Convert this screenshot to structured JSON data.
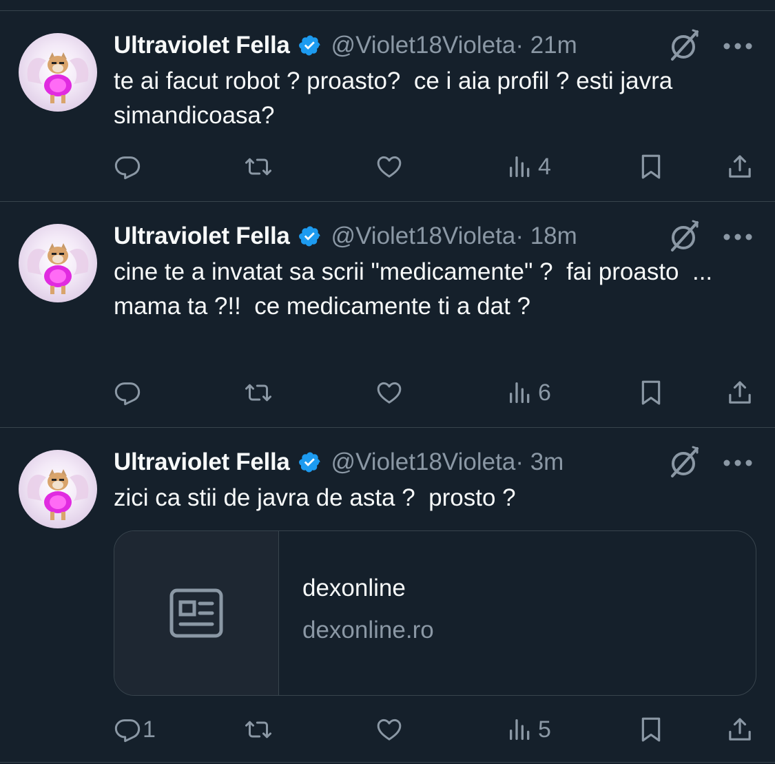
{
  "colors": {
    "background": "#15202b",
    "text": "#f7f9f9",
    "muted": "#8b98a5",
    "divider": "#38444d",
    "verified": "#1d9bf0"
  },
  "tweets": [
    {
      "name": "Ultraviolet Fella",
      "handle": "@Violet18Violeta",
      "time": " · 21m",
      "text": "te ai facut robot ? proasto?  ce i aia profil ? esti javra simandicoasa?",
      "stats": {
        "replies": "",
        "views": "4"
      }
    },
    {
      "name": "Ultraviolet Fella",
      "handle": "@Violet18Violeta",
      "time": " · 18m",
      "text": "cine te a invatat sa scrii \"medicamente\" ?  fai proasto  ...\nmama ta ?!!  ce medicamente ti a dat ?",
      "stats": {
        "replies": "",
        "views": "6"
      }
    },
    {
      "name": "Ultraviolet Fella",
      "handle": "@Violet18Violeta",
      "time": " · 3m",
      "text": "zici ca stii de javra de asta ?  prosto ?",
      "card": {
        "title": "dexonline",
        "domain": "dexonline.ro",
        "icon": "article-icon"
      },
      "stats": {
        "replies": "1",
        "views": "5"
      }
    }
  ],
  "icons": {
    "verified": "verified-badge-icon",
    "grok": "grok-icon",
    "more": "more-icon",
    "reply": "reply-icon",
    "retweet": "retweet-icon",
    "like": "like-icon",
    "views": "views-icon",
    "bookmark": "bookmark-icon",
    "share": "share-icon"
  }
}
